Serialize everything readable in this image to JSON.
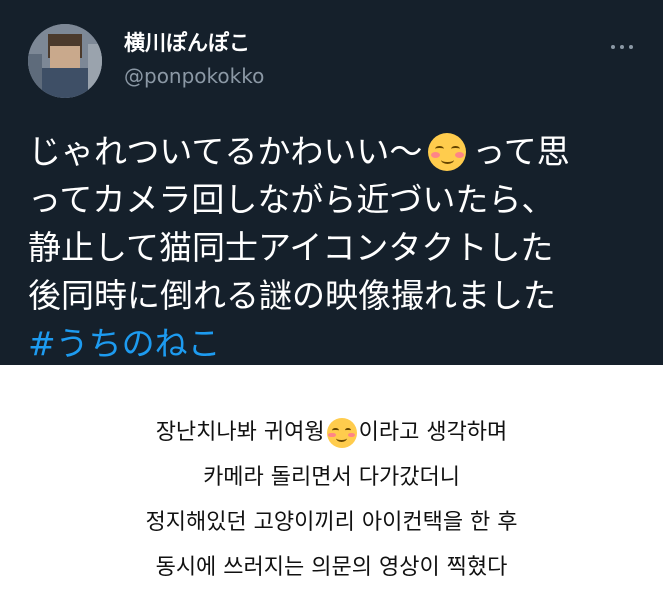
{
  "tweet": {
    "display_name": "横川ぽんぽこ",
    "handle": "@ponpokokko",
    "more_icon": "more-dots-icon",
    "lines": [
      {
        "before": "じゃれついてるかわいい〜",
        "emoji": "smiling-face-icon",
        "after": "って思"
      },
      {
        "text": "ってカメラ回しながら近づいたら、"
      },
      {
        "text": "静止して猫同士アイコンタクトした"
      },
      {
        "text": "後同時に倒れる謎の映像撮れました"
      }
    ],
    "hashtag": "#うちのねこ",
    "colors": {
      "background": "#15202b",
      "hashtag": "#1d9bf0",
      "secondary": "#8b98a5"
    }
  },
  "translation": {
    "lines": [
      {
        "before": "장난치나봐 귀여웡",
        "emoji": "smiling-face-icon",
        "after": "이라고 생각하며"
      },
      {
        "text": "카메라 돌리면서 다가갔더니"
      },
      {
        "text": "정지해있던 고양이끼리 아이컨택을 한 후"
      },
      {
        "text": "동시에 쓰러지는 의문의 영상이 찍혔다"
      }
    ]
  }
}
